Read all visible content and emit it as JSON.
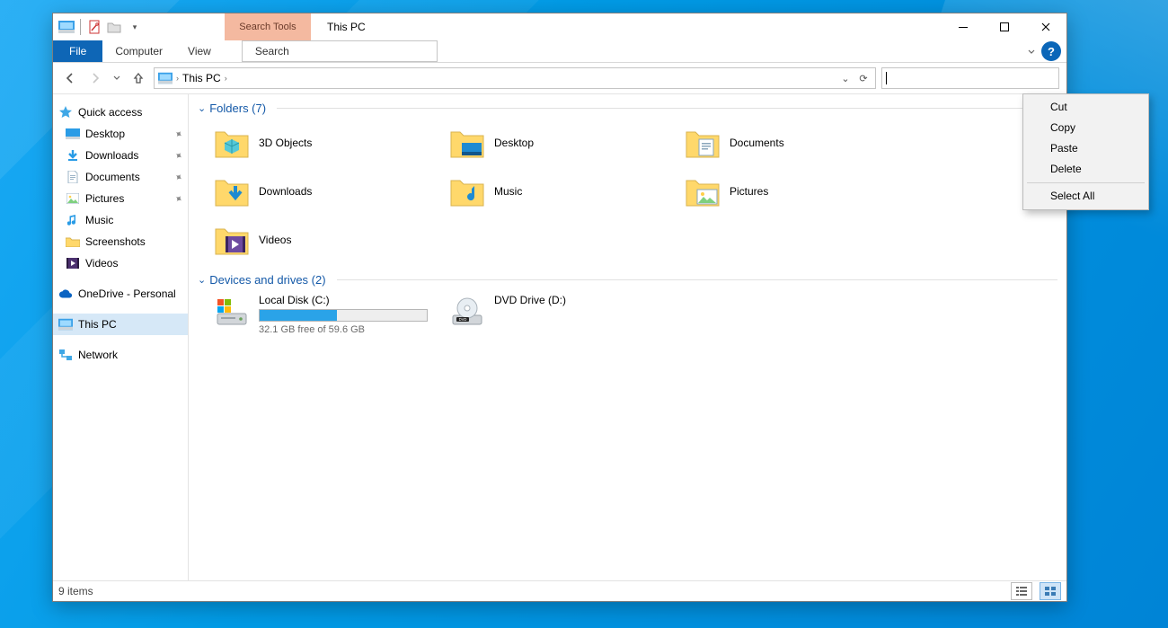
{
  "window_title": "This PC",
  "context_tab_label": "Search Tools",
  "ribbon_tabs": {
    "file": "File",
    "computer": "Computer",
    "view": "View",
    "search": "Search"
  },
  "breadcrumb": {
    "location": "This PC"
  },
  "sidebar": {
    "quick_access": "Quick access",
    "desktop": "Desktop",
    "downloads": "Downloads",
    "documents": "Documents",
    "pictures": "Pictures",
    "music": "Music",
    "screenshots": "Screenshots",
    "videos": "Videos",
    "onedrive": "OneDrive - Personal",
    "this_pc": "This PC",
    "network": "Network"
  },
  "sections": {
    "folders_label": "Folders (7)",
    "drives_label": "Devices and drives (2)"
  },
  "folders": {
    "obj3d": "3D Objects",
    "desktop": "Desktop",
    "documents": "Documents",
    "downloads": "Downloads",
    "music": "Music",
    "pictures": "Pictures",
    "videos": "Videos"
  },
  "drives": {
    "c_label": "Local Disk (C:)",
    "c_sub": "32.1 GB free of 59.6 GB",
    "c_used_pct": 46,
    "dvd_label": "DVD Drive (D:)"
  },
  "status": {
    "items": "9 items"
  },
  "context_menu": {
    "cut": "Cut",
    "copy": "Copy",
    "paste": "Paste",
    "delete": "Delete",
    "select_all": "Select All"
  }
}
